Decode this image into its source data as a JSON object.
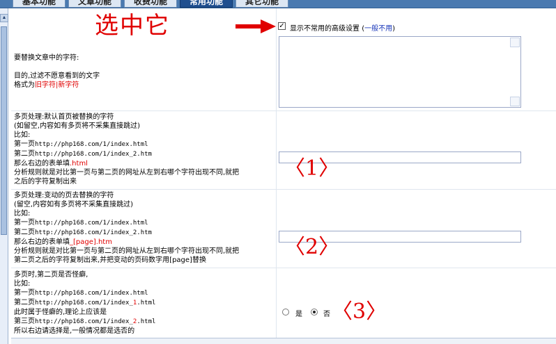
{
  "tabs": [
    {
      "label": "基本功能",
      "active": false
    },
    {
      "label": "文章功能",
      "active": false
    },
    {
      "label": "收费功能",
      "active": false
    },
    {
      "label": "常用功能",
      "active": true
    },
    {
      "label": "其它功能",
      "active": false
    }
  ],
  "annotations": {
    "select_it": "选中它",
    "marker_1": "〈1〉",
    "marker_2": "〈2〉",
    "marker_3": "〈3〉"
  },
  "advanced": {
    "checkbox_checked": true,
    "label": "显示不常用的高级设置",
    "paren_open": "(",
    "link": "一般不用",
    "paren_close": ")"
  },
  "replace": {
    "line1": "要替换文章中的字符:",
    "line2": "目的,过滤不愿意看到的文字",
    "line3_prefix": "格式为",
    "line3_value": "旧字符|新字符",
    "textarea_value": ""
  },
  "multipage": {
    "line1": "多页处理:默认首页被替换的字符",
    "line2": "(如留空,内容如有多页将不采集直接跳过)",
    "line3": "比如:",
    "line4_prefix": "第一页",
    "line4_url": "http://php168.com/1/index.html",
    "line5_prefix": "第二页",
    "line5_url": "http://php168.com/1/index_2.htm",
    "line6_prefix": "那么右边的表单填",
    "line6_value": ".html",
    "line7": "分析规则就是对比第一页与第二页的网址从左到右哪个字符出现不同,就把",
    "line8": "之后的字符复制出来",
    "input_value": ""
  },
  "variable": {
    "line1": "多页处理:变动的页去替换的字符",
    "line2": "(留空,内容如有多页将不采集直接跳过)",
    "line3": "比如:",
    "line4_prefix": "第一页",
    "line4_url": "http://php168.com/1/index.html",
    "line5_prefix": "第二页",
    "line5_url": "http://php168.com/1/index_2.htm",
    "line6_prefix": "那么右边的表单填",
    "line6_value": "_[page].htm",
    "line7": "分析规则就是对比第一页与第二页的网址从左到右哪个字符出现不同,就把",
    "line8": "第二页之后的字符复制出来,并把变动的页码数字用[page]替换",
    "input_value": ""
  },
  "quirk": {
    "line1": "多页时,第二页是否怪癖,",
    "line2": "比如:",
    "line3_prefix": "第一页",
    "line3_url": "http://php168.com/1/index.html",
    "line4_prefix": "第二页",
    "line4_url_a": "http://php168.com/1/index_",
    "line4_url_b": "1",
    "line4_url_c": ".html",
    "line5": "此时属于怪癖的,理论上应该是",
    "line6_prefix": "第三页",
    "line6_url_a": "http://php168.com/1/index_",
    "line6_url_b": "2",
    "line6_url_c": ".html",
    "line7": "所以右边请选择是,一般情况都是选否的",
    "options": [
      {
        "label": "是",
        "selected": false
      },
      {
        "label": "否",
        "selected": true
      }
    ]
  }
}
